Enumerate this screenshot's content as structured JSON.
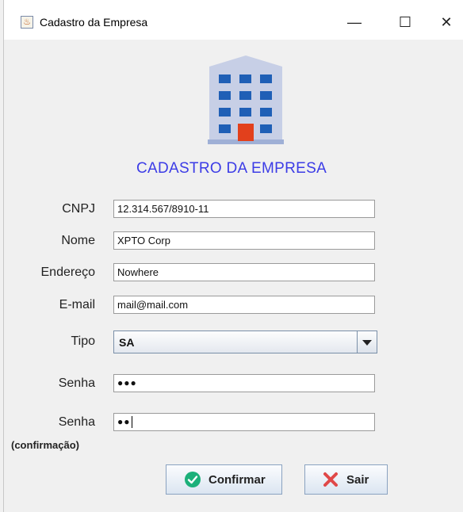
{
  "window": {
    "title": "Cadastro da Empresa",
    "minimize_glyph": "—",
    "maximize_glyph": "☐",
    "close_glyph": "✕"
  },
  "heading": "CADASTRO DA EMPRESA",
  "form": {
    "cnpj_label": "CNPJ",
    "cnpj_value": "12.314.567/8910-11",
    "nome_label": "Nome",
    "nome_value": "XPTO Corp",
    "endereco_label": "Endereço",
    "endereco_value": "Nowhere",
    "email_label": "E-mail",
    "email_value": "mail@mail.com",
    "tipo_label": "Tipo",
    "tipo_value": "SA",
    "senha_label": "Senha",
    "senha_mask": "●●●",
    "senha_conf_label": "Senha",
    "senha_conf_sublabel": "(confirmação)",
    "senha_conf_mask": "●●"
  },
  "buttons": {
    "confirm_label": "Confirmar",
    "exit_label": "Sair"
  },
  "icons": {
    "app": "java-app-icon",
    "building": "building-icon",
    "confirm": "check-circle-icon",
    "exit": "x-icon"
  },
  "colors": {
    "heading": "#3c3ce6",
    "building_windows": "#1f5fb6",
    "building_door": "#e2401c",
    "confirm_icon": "#1cb07a",
    "exit_icon": "#e04848"
  }
}
